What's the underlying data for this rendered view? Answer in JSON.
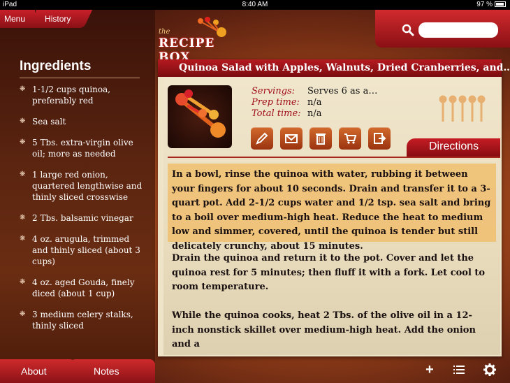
{
  "status_bar": {
    "device": "iPad",
    "time": "8:40 AM",
    "battery": "97 %"
  },
  "nav": {
    "menu_label": "Menu",
    "history_label": "History"
  },
  "logo": {
    "the": "the",
    "name": "RECIPE BOX"
  },
  "search": {
    "placeholder": "",
    "value": ""
  },
  "sidebar": {
    "title": "Ingredients",
    "items": [
      "1-1/2 cups quinoa, preferably red",
      "Sea salt",
      "5 Tbs. extra-virgin olive oil; more as needed",
      "1 large red onion, quartered lengthwise and thinly sliced crosswise",
      "2 Tbs. balsamic vinegar",
      "4 oz. arugula, trimmed and thinly sliced (about 3 cups)",
      "4 oz. aged Gouda, finely diced (about 1 cup)",
      "3 medium celery stalks, thinly sliced"
    ]
  },
  "bottom_tabs": {
    "about": "About",
    "notes": "Notes"
  },
  "recipe": {
    "title": "Quinoa Salad with Apples, Walnuts, Dried Cranberries, and…",
    "servings_label": "Servings:",
    "servings": "Serves 6 as a…",
    "prep_label": "Prep time:",
    "prep": "n/a",
    "total_label": "Total time:",
    "total": "n/a",
    "actions": [
      "edit-icon",
      "mail-icon",
      "trash-icon",
      "cart-icon",
      "export-icon"
    ],
    "directions_label": "Directions",
    "directions": [
      "In a bowl, rinse the quinoa with water, rubbing it between your fingers for about 10 seconds. Drain and transfer it to a 3-quart pot. Add 2-1/2 cups water and 1/2 tsp. sea salt and bring to a boil over medium-high heat. Reduce the heat to medium low and simmer, covered, until the quinoa is tender but still delicately crunchy, about 15 minutes.",
      "Drain the quinoa and return it to the pot. Cover and let the quinoa rest for 5 minutes; then fluff it with a fork. Let cool to room temperature.",
      "While the quinoa cooks, heat 2 Tbs. of the olive oil in a 12-inch nonstick skillet over medium-high heat. Add the onion and a"
    ]
  },
  "toolbar": {
    "add_icon": "plus-icon",
    "list_icon": "list-icon",
    "settings_icon": "gear-icon"
  },
  "colors": {
    "accent_red": "#b51a20",
    "highlight": "#f0be6e",
    "label_red": "#a0101a"
  }
}
